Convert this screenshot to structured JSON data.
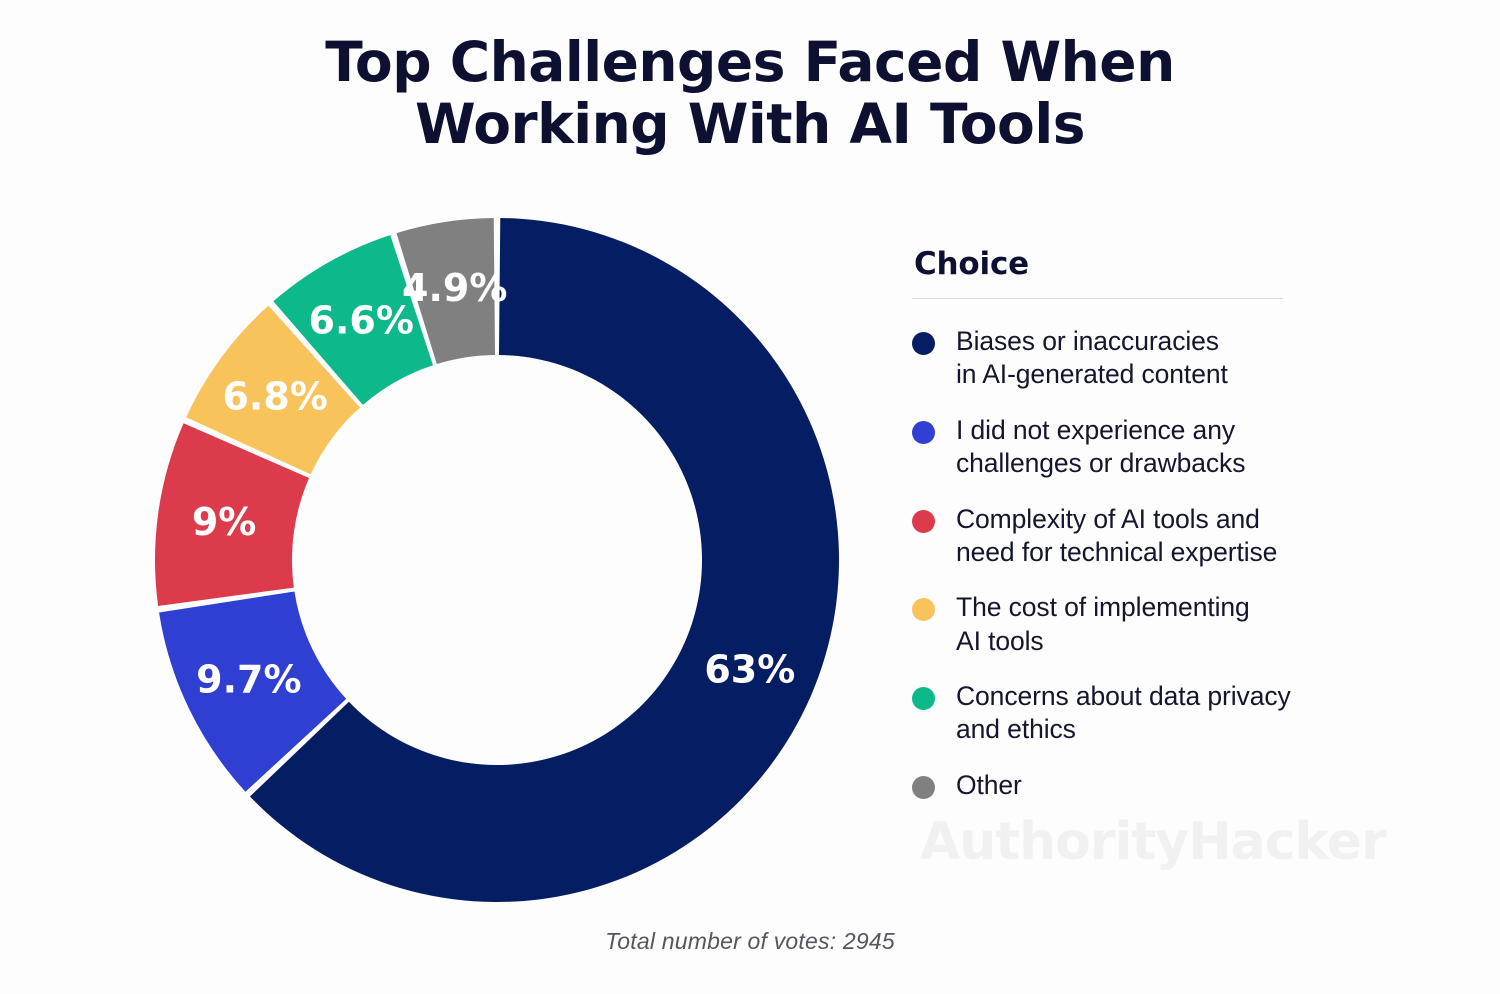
{
  "title": "Top Challenges Faced When\nWorking With AI Tools",
  "legend": {
    "header": "Choice"
  },
  "footer": {
    "note": "Total number of votes: 2945"
  },
  "watermark": {
    "text": "AuthorityHacker"
  },
  "chart_data": {
    "type": "pie",
    "variant": "donut",
    "title": "Top Challenges Faced When Working With AI Tools",
    "legend_title": "Choice",
    "legend_position": "right",
    "total_votes": 2945,
    "total_votes_label": "Total number of votes: 2945",
    "units": "percent",
    "start_angle_deg": 0,
    "direction": "clockwise",
    "inner_radius_ratio": 0.6,
    "categories": [
      "Biases or inaccuracies in AI-generated content",
      "I did not experience any challenges or drawbacks",
      "Complexity of AI tools and need for technical expertise",
      "The cost of implementing AI tools",
      "Concerns about data privacy and ethics",
      "Other"
    ],
    "values": [
      63,
      9.7,
      9,
      6.8,
      6.6,
      4.9
    ],
    "value_labels": [
      "63%",
      "9.7%",
      "9%",
      "6.8%",
      "6.6%",
      "4.9%"
    ],
    "colors": [
      "#051d63",
      "#2f3fd1",
      "#dc3b4c",
      "#f9c35c",
      "#0db98a",
      "#808080"
    ],
    "slices": [
      {
        "label": "Biases or inaccuracies\nin AI-generated content",
        "legend_label": "Biases or inaccuracies\nin AI-generated content",
        "value": 63,
        "value_label": "63%",
        "color": "#051d63",
        "dot_name": "legend-dot-navy"
      },
      {
        "label": "I did not experience any\nchallenges or drawbacks",
        "legend_label": "I did not experience any\nchallenges or drawbacks",
        "value": 9.7,
        "value_label": "9.7%",
        "color": "#2f3fd1",
        "dot_name": "legend-dot-blue"
      },
      {
        "label": "Complexity of AI tools and\nneed for technical expertise",
        "legend_label": "Complexity of AI tools and\nneed for technical expertise",
        "value": 9,
        "value_label": "9%",
        "color": "#dc3b4c",
        "dot_name": "legend-dot-red"
      },
      {
        "label": "The cost of implementing\nAI tools",
        "legend_label": "The cost of implementing\nAI tools",
        "value": 6.8,
        "value_label": "6.8%",
        "color": "#f9c35c",
        "dot_name": "legend-dot-yellow"
      },
      {
        "label": "Concerns about data privacy\nand ethics",
        "legend_label": "Concerns about data privacy\nand ethics",
        "value": 6.6,
        "value_label": "6.6%",
        "color": "#0db98a",
        "dot_name": "legend-dot-teal"
      },
      {
        "label": "Other",
        "legend_label": "Other",
        "value": 4.9,
        "value_label": "4.9%",
        "color": "#808080",
        "dot_name": "legend-dot-gray"
      }
    ]
  }
}
